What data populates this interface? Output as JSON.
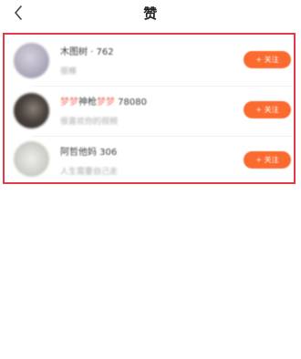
{
  "header": {
    "title": "赞",
    "back_icon": "chevron-left-icon"
  },
  "likes": [
    {
      "name": "木图树 · 762",
      "subtitle": "很棒",
      "follow_label": "+ 关注"
    },
    {
      "name_parts": [
        "梦梦",
        "神枪",
        "梦梦",
        " 78080"
      ],
      "subtitle": "很喜欢你的视频",
      "follow_label": "+ 关注"
    },
    {
      "name": "阿哲他妈 306",
      "subtitle": "人生需要自己走",
      "follow_label": "+ 关注"
    }
  ],
  "colors": {
    "accent": "#fb6a2e",
    "highlight_border": "#e03b47",
    "name_accent": "#f07a6a"
  }
}
